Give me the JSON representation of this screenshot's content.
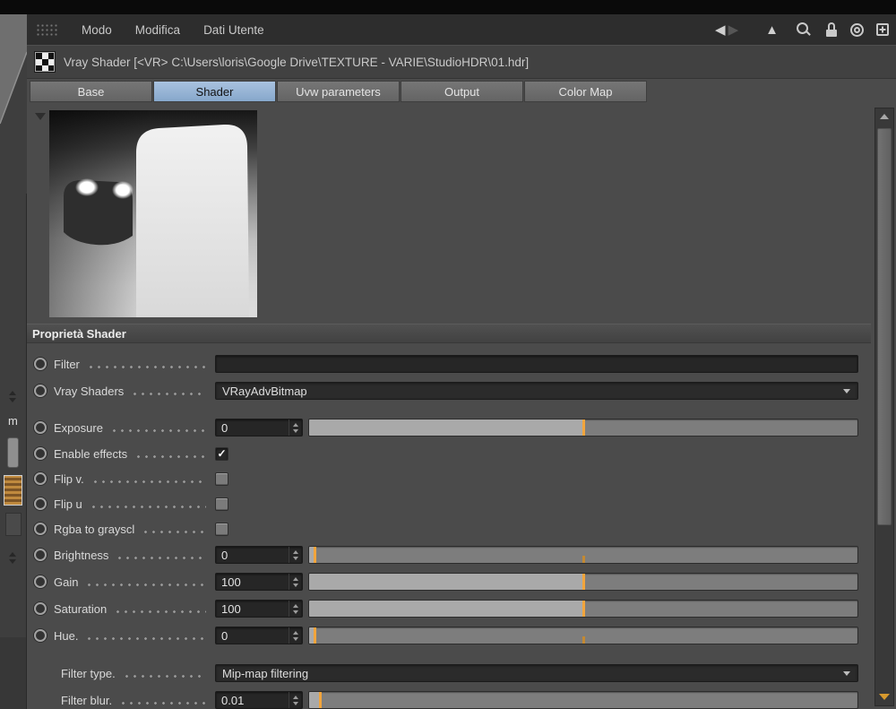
{
  "glyphs": {
    "back": "◀",
    "forward": "▶",
    "up": "▲",
    "check": "✓"
  },
  "colors": {
    "accent_orange": "#f2a53c",
    "tab_active_blue": "#8fadd0",
    "panel_background": "#4b4b4b",
    "field_background": "#262626"
  },
  "menu": {
    "items": [
      {
        "label": "Modo"
      },
      {
        "label": "Modifica"
      },
      {
        "label": "Dati Utente"
      }
    ]
  },
  "title_bar": {
    "title": "Vray Shader [<VR>  C:\\Users\\loris\\Google Drive\\TEXTURE - VARIE\\StudioHDR\\01.hdr]"
  },
  "tabs": [
    {
      "label": "Base",
      "selected": false
    },
    {
      "label": "Shader",
      "selected": true
    },
    {
      "label": "Uvw parameters",
      "selected": false
    },
    {
      "label": "Output",
      "selected": false
    },
    {
      "label": "Color Map",
      "selected": false
    }
  ],
  "panel": {
    "section_title": "Proprietà Shader",
    "params": {
      "filter": {
        "label": "Filter",
        "value": ""
      },
      "vray_shaders": {
        "label": "Vray Shaders",
        "value": "VRayAdvBitmap"
      },
      "exposure": {
        "label": "Exposure",
        "value": "0",
        "slider": {
          "pct": 50
        }
      },
      "enable_effects": {
        "label": "Enable effects",
        "checked": true
      },
      "flip_v": {
        "label": "Flip v.",
        "checked": false
      },
      "flip_u": {
        "label": "Flip u",
        "checked": false
      },
      "rgba_to_grayscl": {
        "label": "Rgba to grayscl",
        "checked": false
      },
      "brightness": {
        "label": "Brightness",
        "value": "0",
        "slider": {
          "pct": 1,
          "notch": 50
        }
      },
      "gain": {
        "label": "Gain",
        "value": "100",
        "slider": {
          "pct": 50
        }
      },
      "saturation": {
        "label": "Saturation",
        "value": "100",
        "slider": {
          "pct": 50
        }
      },
      "hue": {
        "label": "Hue.",
        "value": "0",
        "slider": {
          "pct": 1,
          "notch": 50
        }
      },
      "filter_type": {
        "label": "Filter type.",
        "value": "Mip-map filtering"
      },
      "filter_blur": {
        "label": "Filter blur.",
        "value": "0.01",
        "slider": {
          "pct": 2
        }
      }
    }
  },
  "left_strip": {
    "label": "m"
  }
}
